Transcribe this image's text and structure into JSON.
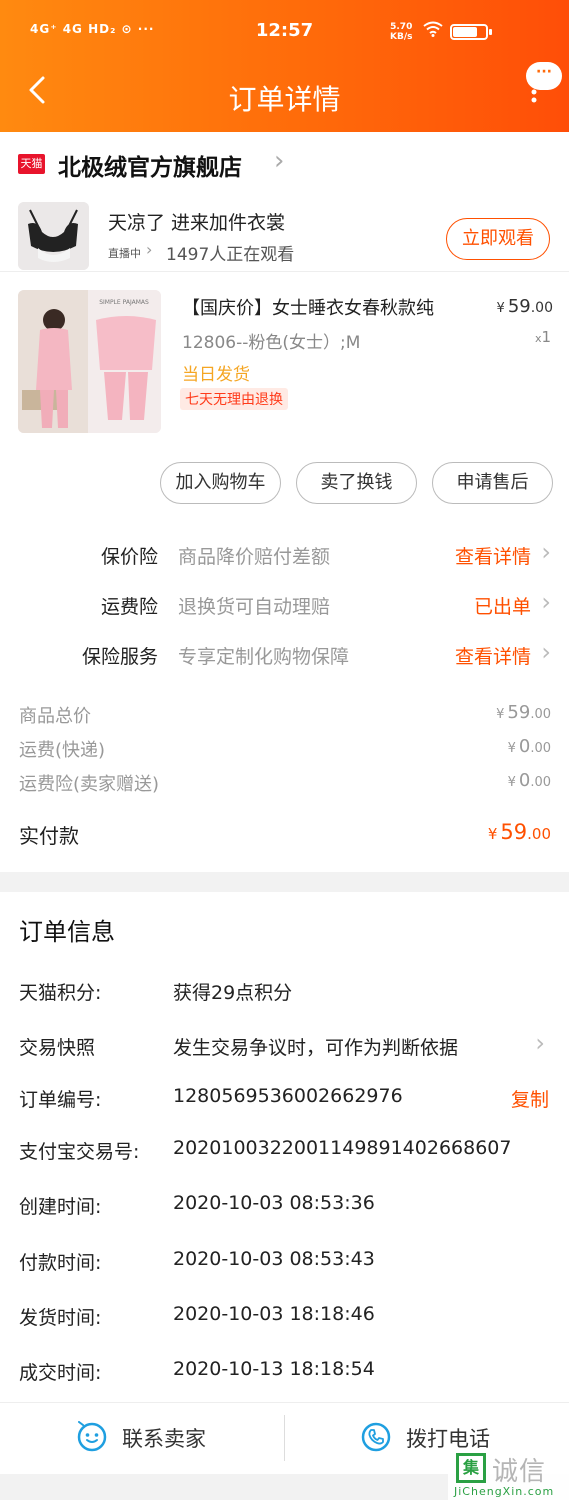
{
  "status_bar": {
    "signal_text": "4G⁺ 4G HD₂ ⊙ ···",
    "time": "12:57",
    "speed_value": "5.70",
    "speed_unit": "KB/s",
    "battery_level": 0.75
  },
  "nav": {
    "title": "订单详情",
    "more_bubble": "···"
  },
  "shop": {
    "badge": "天猫",
    "name": "北极绒官方旗舰店"
  },
  "live": {
    "title": "天凉了 进来加件衣裳",
    "tag": "直播中",
    "viewers": "1497人正在观看",
    "watch_button": "立即观看"
  },
  "product": {
    "title": "【国庆价】女士睡衣女春秋款纯",
    "price_currency": "¥",
    "price_int": "59",
    "price_dec": ".00",
    "sku": "12806--粉色(女士）;M",
    "qty_x": "x",
    "qty": "1",
    "ship_today": "当日发货",
    "return_policy": "七天无理由退换",
    "image_caption": "SIMPLE PAJAMAS"
  },
  "actions": {
    "add_cart": "加入购物车",
    "resell": "卖了换钱",
    "after_sale": "申请售后"
  },
  "insurance": [
    {
      "label": "保价险",
      "desc": "商品降价赔付差额",
      "link": "查看详情"
    },
    {
      "label": "运费险",
      "desc": "退换货可自动理赔",
      "link": "已出单"
    },
    {
      "label": "保险服务",
      "desc": "专享定制化购物保障",
      "link": "查看详情"
    }
  ],
  "costs": [
    {
      "label": "商品总价",
      "cur": "¥",
      "int": "59",
      "dec": ".00"
    },
    {
      "label": "运费(快递)",
      "cur": "¥",
      "int": "0",
      "dec": ".00"
    },
    {
      "label": "运费险(卖家赠送)",
      "cur": "¥",
      "int": "0",
      "dec": ".00"
    }
  ],
  "paid": {
    "label": "实付款",
    "cur": "¥",
    "int": "59",
    "dec": ".00"
  },
  "order_info": {
    "title": "订单信息",
    "rows": [
      {
        "label": "天猫积分:",
        "value": "获得29点积分"
      },
      {
        "label": "交易快照",
        "value": "发生交易争议时，可作为判断依据"
      },
      {
        "label": "订单编号:",
        "value": "1280569536002662976"
      },
      {
        "label": "支付宝交易号:",
        "value": "2020100322001149891402668607"
      },
      {
        "label": "创建时间:",
        "value": "2020-10-03 08:53:36"
      },
      {
        "label": "付款时间:",
        "value": "2020-10-03 08:53:43"
      },
      {
        "label": "发货时间:",
        "value": "2020-10-03 18:18:46"
      },
      {
        "label": "成交时间:",
        "value": "2020-10-13 18:18:54"
      }
    ],
    "copy_label": "复制"
  },
  "bottom_bar": {
    "contact_seller": "联系卖家",
    "call_phone": "拨打电话"
  },
  "watermark": {
    "brand": "诚信",
    "url": "JiChengXin.com"
  },
  "colors": {
    "accent": "#ff5000",
    "header_start": "#ff8a10",
    "header_end": "#ff4e08",
    "tmall_red": "#e8142c",
    "ship_today": "#f5a623",
    "icon_blue": "#1f9fe0"
  }
}
